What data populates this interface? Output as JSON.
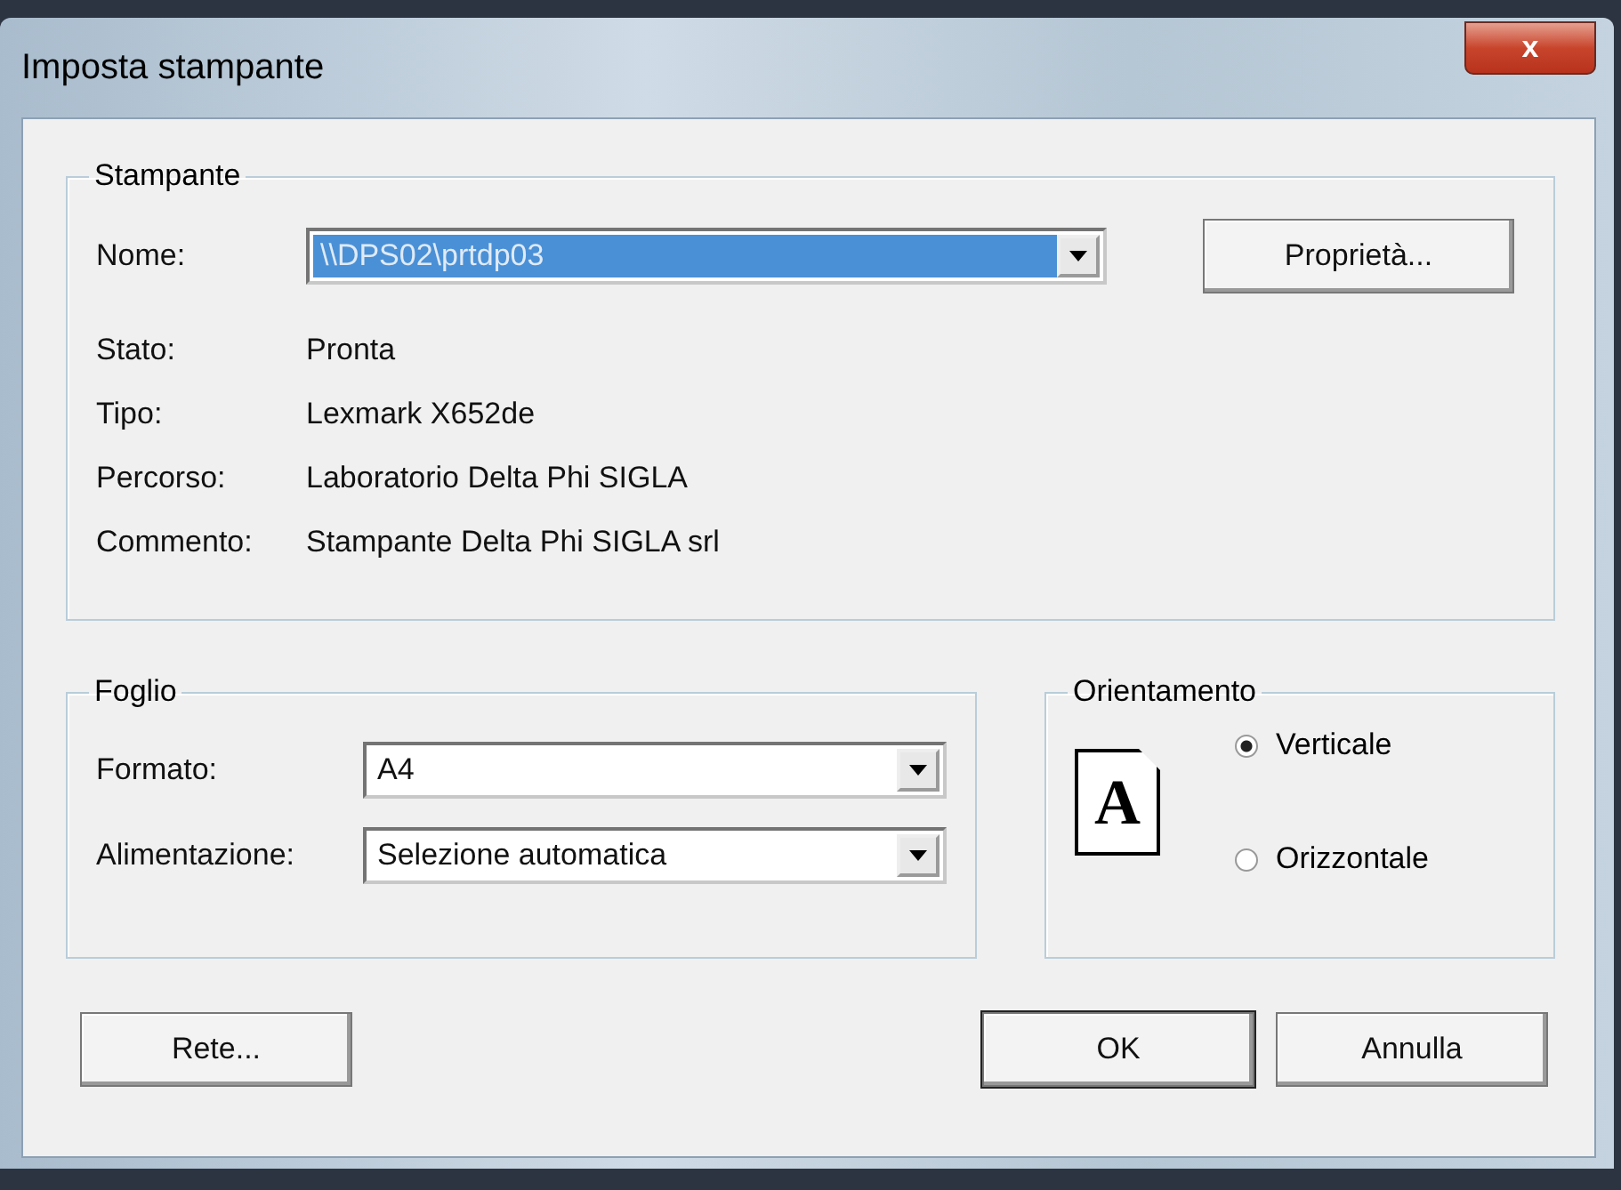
{
  "window": {
    "title": "Imposta stampante",
    "close": "x"
  },
  "printer": {
    "legend": "Stampante",
    "name_label": "Nome:",
    "name_value": "\\\\DPS02\\prtdp03",
    "properties_button": "Proprietà...",
    "info": [
      {
        "label": "Stato:",
        "value": "Pronta"
      },
      {
        "label": "Tipo:",
        "value": "Lexmark X652de"
      },
      {
        "label": "Percorso:",
        "value": "Laboratorio Delta Phi SIGLA"
      },
      {
        "label": "Commento:",
        "value": "Stampante Delta Phi SIGLA srl"
      }
    ]
  },
  "paper": {
    "legend": "Foglio",
    "fields": [
      {
        "label": "Formato:",
        "value": "A4"
      },
      {
        "label": "Alimentazione:",
        "value": "Selezione automatica"
      }
    ]
  },
  "orientation": {
    "legend": "Orientamento",
    "icon_letter": "A",
    "options": [
      {
        "label": "Verticale",
        "selected": true
      },
      {
        "label": "Orizzontale",
        "selected": false
      }
    ]
  },
  "buttons": {
    "network": "Rete...",
    "ok": "OK",
    "cancel": "Annulla"
  }
}
